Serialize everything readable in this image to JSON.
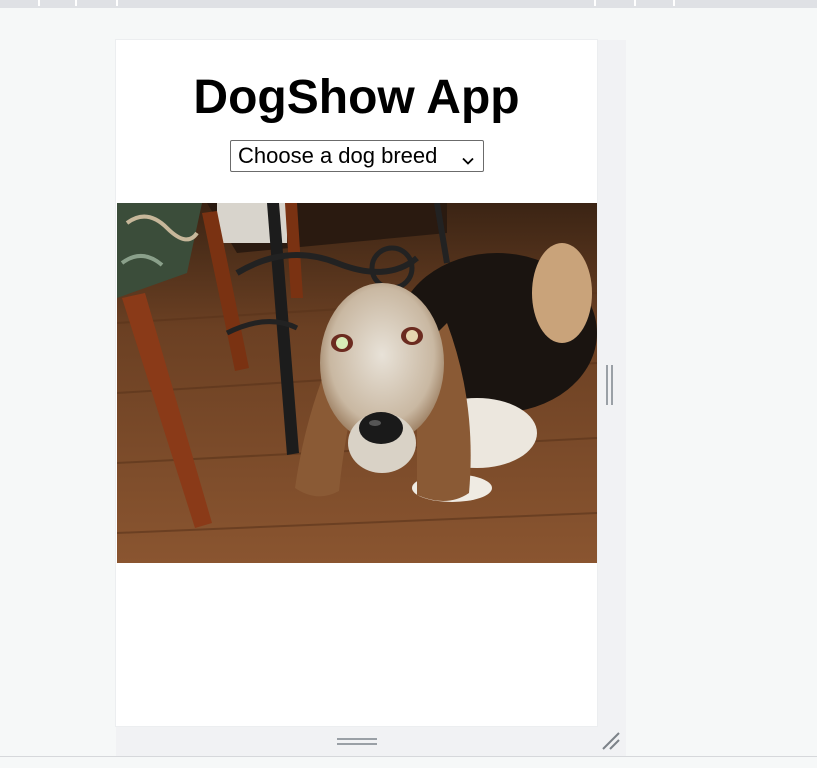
{
  "app": {
    "title": "DogShow App"
  },
  "breed_select": {
    "selected_label": "Choose a dog breed"
  },
  "photo": {
    "subject": "basset hound",
    "icon": "dog-photo"
  },
  "colors": {
    "page_background": "#f6f8f8",
    "frame_background": "#f1f2f4",
    "viewport_background": "#ffffff",
    "toolbar_strip": "#dfe1e5",
    "handle": "#9aa0a6"
  }
}
